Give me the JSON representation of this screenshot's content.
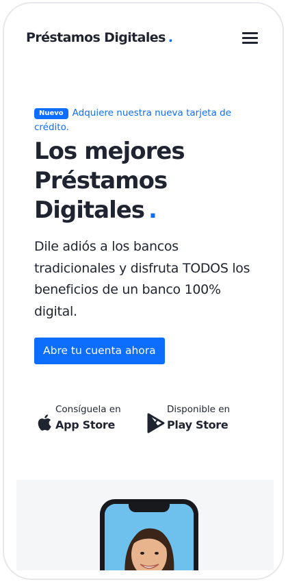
{
  "navbar": {
    "brand": "Préstamos Digitales",
    "brand_dot": ".",
    "menu_icon": "hamburger-menu-icon"
  },
  "announcement": {
    "badge": "Nuevo",
    "text": "Adquiere nuestra nueva tarjeta de crédito."
  },
  "hero": {
    "title": "Los mejores Préstamos Digitales",
    "title_dot": ".",
    "description": "Dile adiós a los bancos tradicionales y disfruta TODOS los beneficios de un banco 100% digital.",
    "cta_label": "Abre tu cuenta ahora"
  },
  "stores": [
    {
      "small": "Consíguela en",
      "big": "App Store",
      "icon": "apple-icon"
    },
    {
      "small": "Disponible en",
      "big": "Play Store",
      "icon": "play-store-icon"
    }
  ],
  "colors": {
    "accent": "#0d6efd",
    "text": "#1f2430",
    "showcase_bg": "#f5f6f8",
    "phone_screen": "#6ec1ec"
  }
}
